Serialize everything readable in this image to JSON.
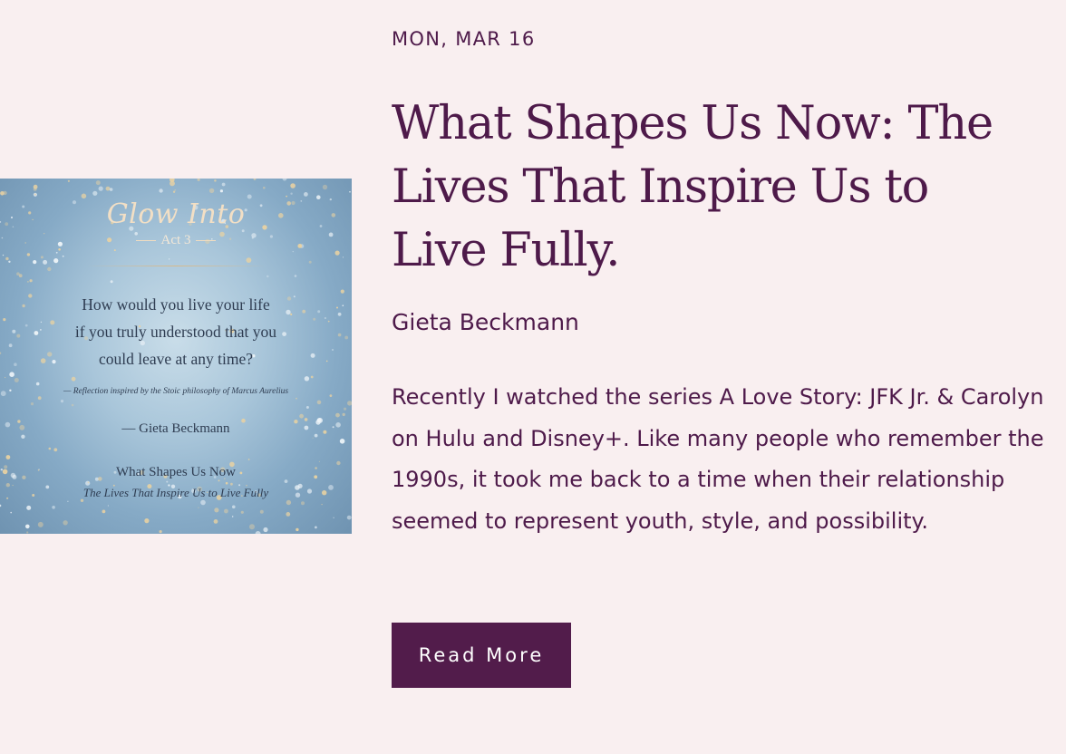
{
  "post": {
    "date": "MON, MAR 16",
    "title": "What Shapes Us Now: The Lives That Inspire Us to Live Fully.",
    "author": "Gieta Beckmann",
    "excerpt": "Recently I watched the series A Love Story: JFK Jr. & Carolyn on Hulu and Disney+. Like many people who remember the 1990s, it took me back to a time when their relationship seemed to represent youth, style, and possibility.",
    "read_more_label": "Read More"
  },
  "thumbnail": {
    "brand": "Glow Into",
    "act": "Act 3",
    "quote_lines": [
      "How would you live your life",
      "if you truly understood that you",
      "could leave at any time?"
    ],
    "attribution": "— Reflection inspired by the Stoic philosophy of Marcus Aurelius",
    "author": "— Gieta Beckmann",
    "series": "What Shapes Us Now",
    "subtitle": "The Lives That Inspire Us to Live Fully"
  },
  "colors": {
    "background": "#f9eff0",
    "accent": "#521c4b",
    "text": "#4e1a4a"
  }
}
